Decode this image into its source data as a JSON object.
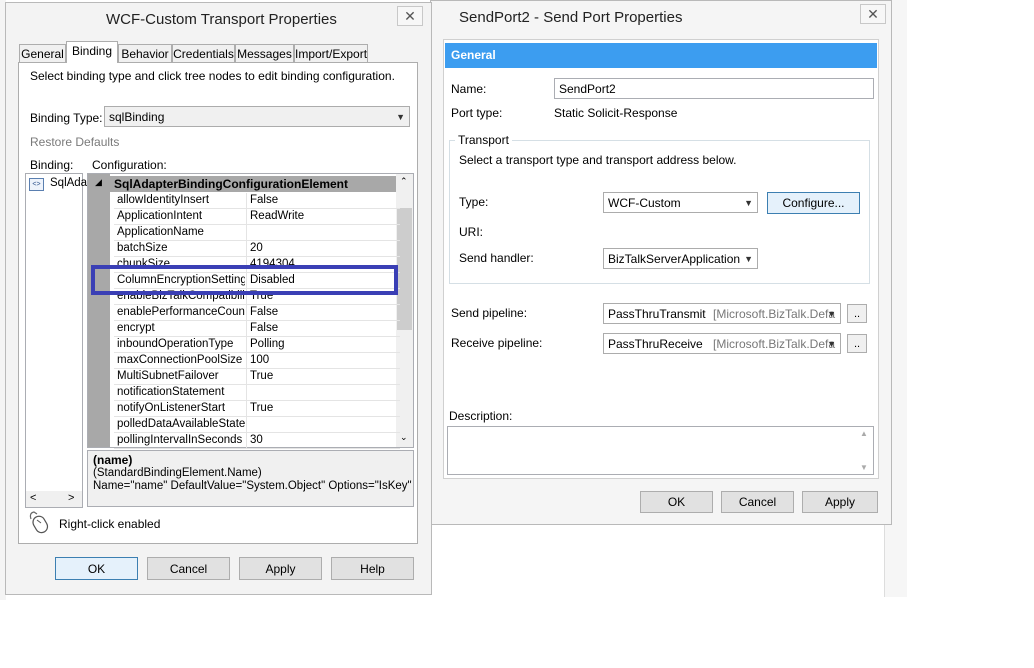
{
  "wcf": {
    "title": "WCF-Custom Transport Properties",
    "close": "✕",
    "tabs": [
      "General",
      "Binding",
      "Behavior",
      "Credentials",
      "Messages",
      "Import/Export"
    ],
    "instruction": "Select binding type and click tree nodes to edit binding configuration.",
    "binding_type_label": "Binding Type:",
    "binding_type_value": "sqlBinding",
    "restore_defaults": "Restore Defaults",
    "binding_label": "Binding:",
    "configuration_label": "Configuration:",
    "tree_item": "SqlAda",
    "group_name": "SqlAdapterBindingConfigurationElement",
    "properties": [
      {
        "name": "allowIdentityInsert",
        "value": "False"
      },
      {
        "name": "ApplicationIntent",
        "value": "ReadWrite"
      },
      {
        "name": "ApplicationName",
        "value": ""
      },
      {
        "name": "batchSize",
        "value": "20"
      },
      {
        "name": "chunkSize",
        "value": "4194304"
      },
      {
        "name": "ColumnEncryptionSetting",
        "value": "Disabled"
      },
      {
        "name": "enableBizTalkCompatibility",
        "value": "True"
      },
      {
        "name": "enablePerformanceCounters",
        "value": "False"
      },
      {
        "name": "encrypt",
        "value": "False"
      },
      {
        "name": "inboundOperationType",
        "value": "Polling"
      },
      {
        "name": "maxConnectionPoolSize",
        "value": "100"
      },
      {
        "name": "MultiSubnetFailover",
        "value": "True"
      },
      {
        "name": "notificationStatement",
        "value": ""
      },
      {
        "name": "notifyOnListenerStart",
        "value": "True"
      },
      {
        "name": "polledDataAvailableStatement",
        "value": ""
      },
      {
        "name": "pollingIntervalInSeconds",
        "value": "30"
      }
    ],
    "desc_title": "(name)",
    "desc_line1": "(StandardBindingElement.Name)",
    "desc_line2": "Name=\"name\" DefaultValue=\"System.Object\" Options=\"IsKey\"",
    "right_click": "Right-click enabled",
    "buttons": {
      "ok": "OK",
      "cancel": "Cancel",
      "apply": "Apply",
      "help": "Help"
    }
  },
  "send": {
    "title": "SendPort2 - Send Port Properties",
    "close": "✕",
    "section_header": "General",
    "name_label": "Name:",
    "name_value": "SendPort2",
    "port_type_label": "Port type:",
    "port_type_value": "Static Solicit-Response",
    "transport_group": "Transport",
    "transport_instruction": "Select a transport type and transport address below.",
    "type_label": "Type:",
    "type_value": "WCF-Custom",
    "configure_button": "Configure...",
    "uri_label": "URI:",
    "send_handler_label": "Send handler:",
    "send_handler_value": "BizTalkServerApplication",
    "send_pipeline_label": "Send pipeline:",
    "send_pipeline_value": "PassThruTransmit",
    "send_pipeline_assembly": "[Microsoft.BizTalk.Defa",
    "receive_pipeline_label": "Receive pipeline:",
    "receive_pipeline_value": "PassThruReceive",
    "receive_pipeline_assembly": "[Microsoft.BizTalk.Defa",
    "ellipsis": "..",
    "description_label": "Description:",
    "buttons": {
      "ok": "OK",
      "cancel": "Cancel",
      "apply": "Apply"
    }
  },
  "colors": {
    "header_blue": "#3c9df0",
    "highlight_box": "#3a3fb5"
  }
}
